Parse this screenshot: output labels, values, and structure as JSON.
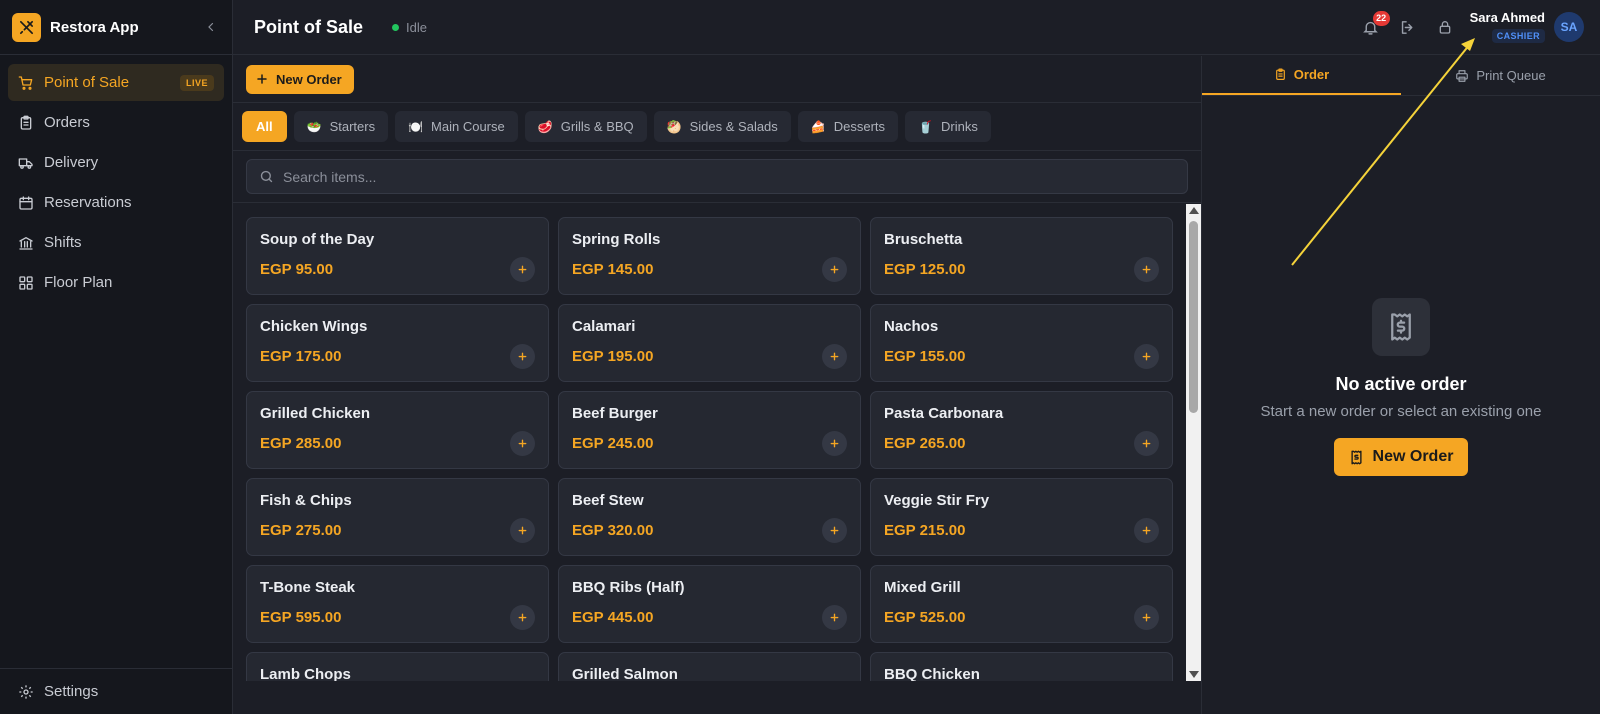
{
  "app": {
    "name": "Restora App"
  },
  "sidebar": {
    "items": [
      {
        "label": "Point of Sale",
        "badge": "LIVE",
        "icon": "cart-icon"
      },
      {
        "label": "Orders",
        "icon": "clipboard-icon"
      },
      {
        "label": "Delivery",
        "icon": "truck-icon"
      },
      {
        "label": "Reservations",
        "icon": "calendar-icon"
      },
      {
        "label": "Shifts",
        "icon": "bank-icon"
      },
      {
        "label": "Floor Plan",
        "icon": "grid-icon"
      }
    ],
    "settings_label": "Settings"
  },
  "header": {
    "title": "Point of Sale",
    "status": "Idle",
    "notifications_count": "22",
    "user_name": "Sara Ahmed",
    "user_role": "CASHIER",
    "user_initials": "SA"
  },
  "toolbar": {
    "new_order_label": "New Order"
  },
  "categories": [
    {
      "label": "All",
      "emoji": ""
    },
    {
      "label": "Starters",
      "emoji": "🥗"
    },
    {
      "label": "Main Course",
      "emoji": "🍽️"
    },
    {
      "label": "Grills & BBQ",
      "emoji": "🥩"
    },
    {
      "label": "Sides & Salads",
      "emoji": "🥙"
    },
    {
      "label": "Desserts",
      "emoji": "🍰"
    },
    {
      "label": "Drinks",
      "emoji": "🥤"
    }
  ],
  "search": {
    "placeholder": "Search items..."
  },
  "menu_items": [
    {
      "name": "Soup of the Day",
      "price": "EGP 95.00"
    },
    {
      "name": "Spring Rolls",
      "price": "EGP 145.00"
    },
    {
      "name": "Bruschetta",
      "price": "EGP 125.00"
    },
    {
      "name": "Chicken Wings",
      "price": "EGP 175.00"
    },
    {
      "name": "Calamari",
      "price": "EGP 195.00"
    },
    {
      "name": "Nachos",
      "price": "EGP 155.00"
    },
    {
      "name": "Grilled Chicken",
      "price": "EGP 285.00"
    },
    {
      "name": "Beef Burger",
      "price": "EGP 245.00"
    },
    {
      "name": "Pasta Carbonara",
      "price": "EGP 265.00"
    },
    {
      "name": "Fish & Chips",
      "price": "EGP 275.00"
    },
    {
      "name": "Beef Stew",
      "price": "EGP 320.00"
    },
    {
      "name": "Veggie Stir Fry",
      "price": "EGP 215.00"
    },
    {
      "name": "T-Bone Steak",
      "price": "EGP 595.00"
    },
    {
      "name": "BBQ Ribs (Half)",
      "price": "EGP 445.00"
    },
    {
      "name": "Mixed Grill",
      "price": "EGP 525.00"
    },
    {
      "name": "Lamb Chops",
      "price": ""
    },
    {
      "name": "Grilled Salmon",
      "price": ""
    },
    {
      "name": "BBQ Chicken",
      "price": ""
    }
  ],
  "panel": {
    "tabs": [
      {
        "label": "Order"
      },
      {
        "label": "Print Queue"
      }
    ],
    "empty_title": "No active order",
    "empty_subtitle": "Start a new order or select an existing one",
    "new_order_label": "New Order"
  },
  "colors": {
    "accent": "#f5a623",
    "background": "#1c1e26",
    "sidebar": "#15171d",
    "card": "#252831",
    "status_idle": "#22c55e",
    "badge": "#e53935",
    "annotation_arrow": "#f5d33a"
  }
}
